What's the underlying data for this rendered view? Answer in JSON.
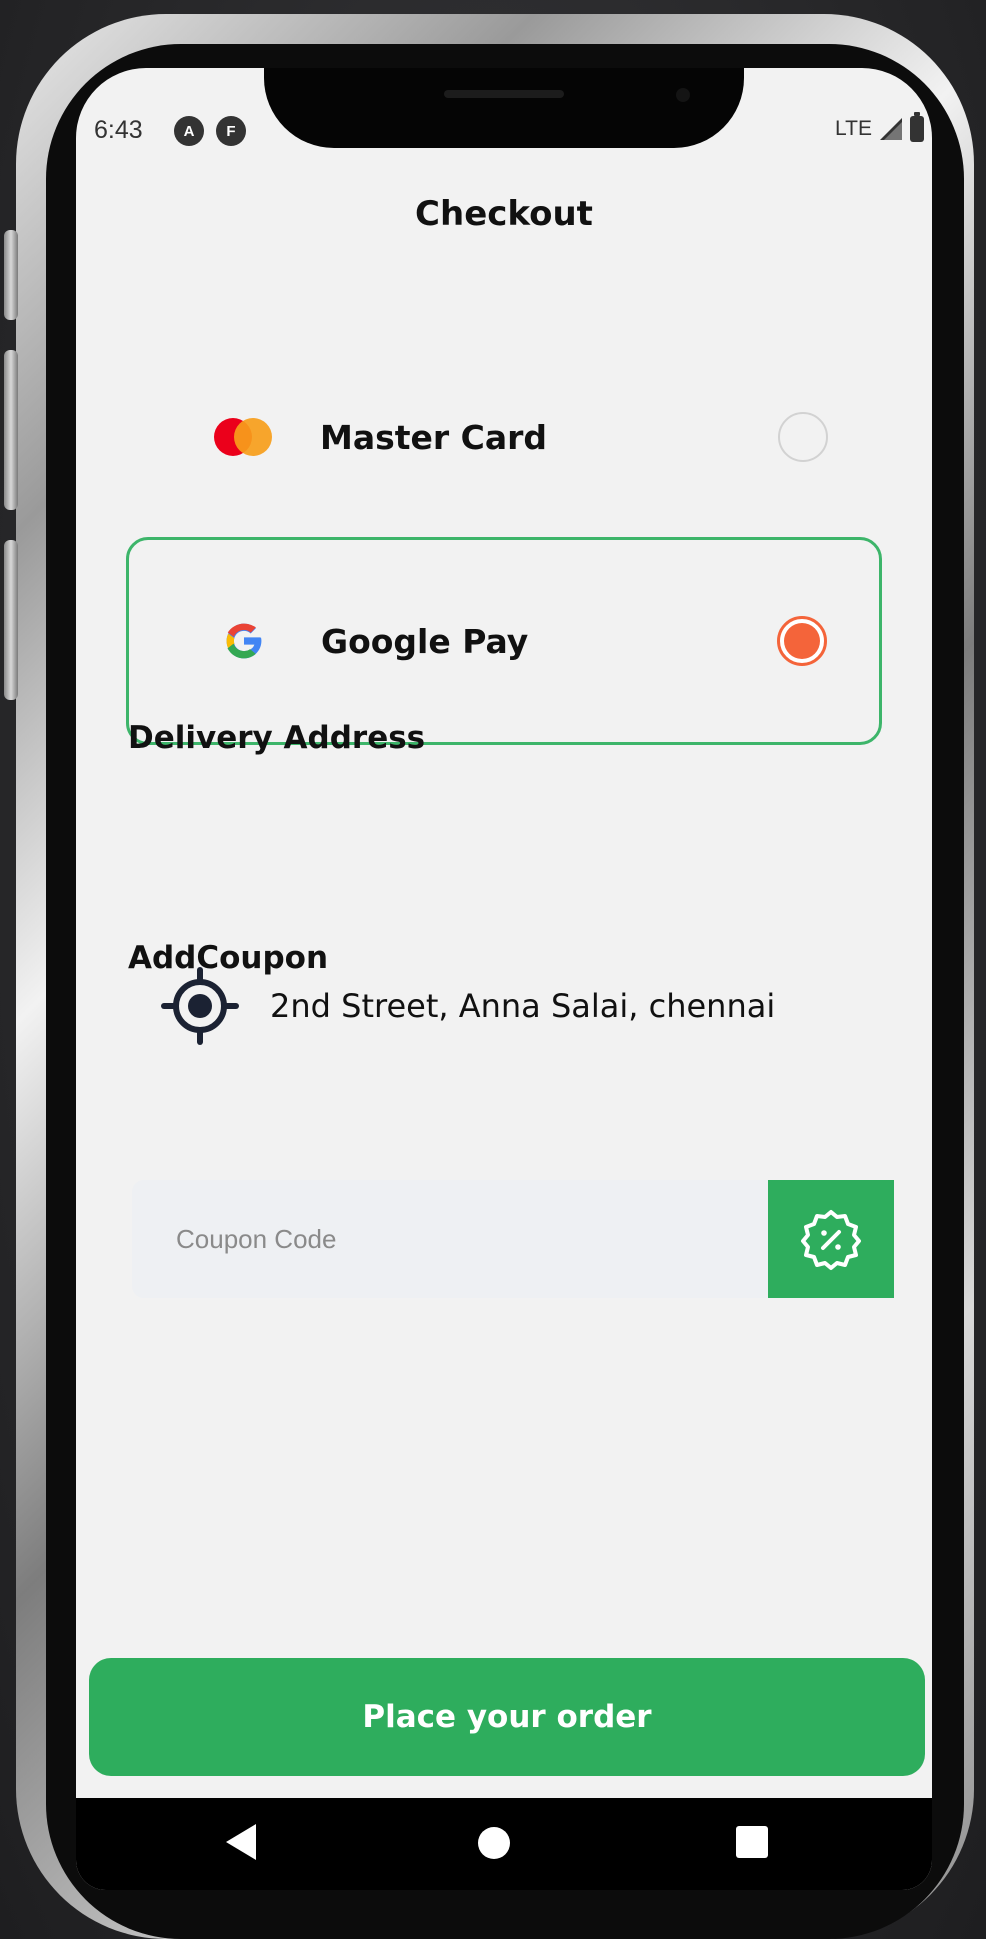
{
  "status_bar": {
    "time": "6:43",
    "app_icon_1": "A",
    "app_icon_2": "F",
    "network": "LTE"
  },
  "header": {
    "title": "Checkout"
  },
  "payment_methods": [
    {
      "label": "Master Card",
      "selected": false,
      "icon": "mastercard-logo"
    },
    {
      "label": "Google Pay",
      "selected": true,
      "icon": "google-logo"
    }
  ],
  "delivery": {
    "heading": "Delivery Address",
    "address": "2nd Street, Anna Salai, chennai",
    "icon": "location-target-icon"
  },
  "coupon": {
    "heading": "AddCoupon",
    "placeholder": "Coupon Code",
    "value": "",
    "button_icon": "discount-badge-icon"
  },
  "footer": {
    "place_order_label": "Place your order"
  },
  "colors": {
    "primary_green": "#2ead5d",
    "selected_border": "#3db56a",
    "radio_selected": "#f4643a",
    "background": "#f2f2f2",
    "text": "#111111"
  }
}
